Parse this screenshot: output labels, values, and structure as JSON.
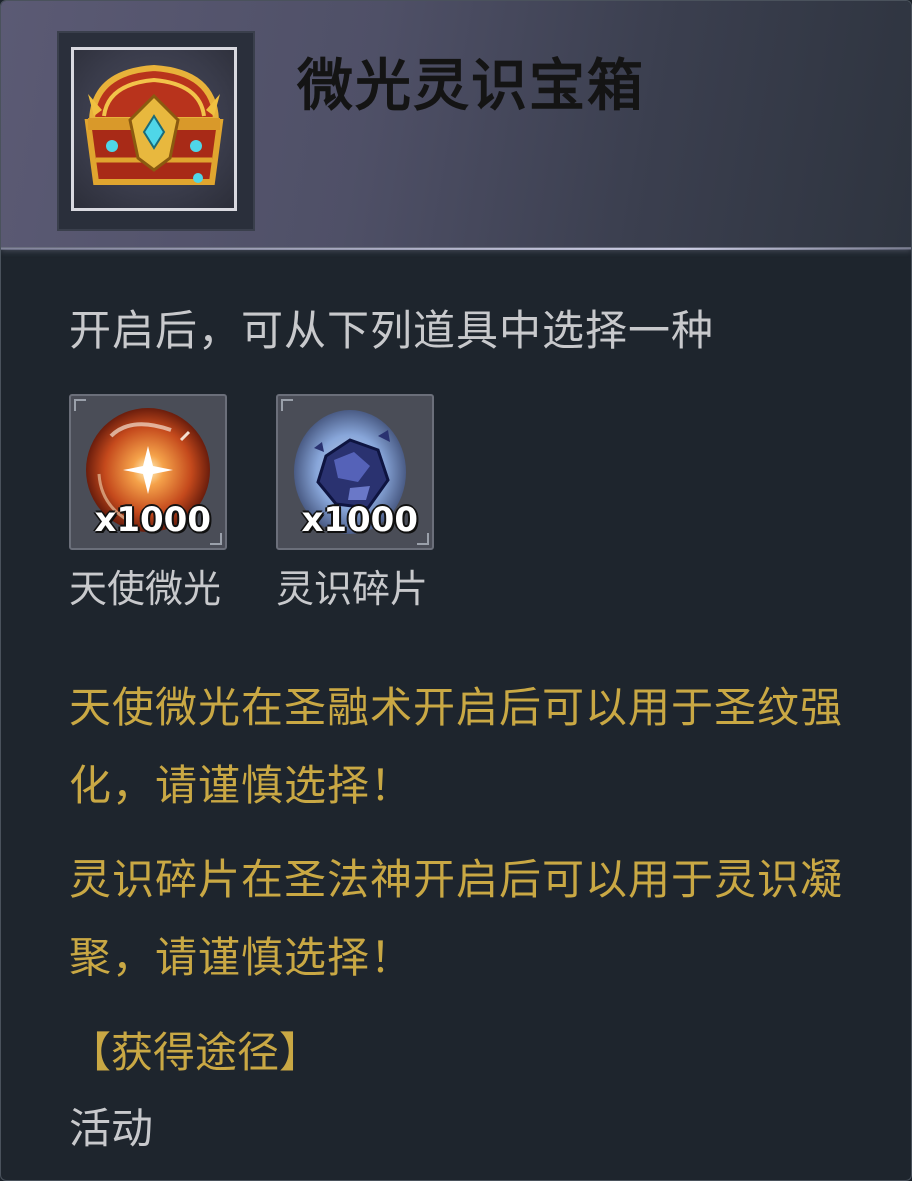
{
  "header": {
    "title": "微光灵识宝箱",
    "icon": "treasure-chest-icon"
  },
  "description": "开启后，可从下列道具中选择一种",
  "items": [
    {
      "name": "天使微光",
      "quantity": "x1000",
      "icon": "glowing-orb-icon",
      "color": "#e0622a"
    },
    {
      "name": "灵识碎片",
      "quantity": "x1000",
      "icon": "crystal-shard-icon",
      "color": "#3a4aa8"
    }
  ],
  "notes": [
    "天使微光在圣融术开启后可以用于圣纹强化，请谨慎选择！",
    "灵识碎片在圣法神开启后可以用于灵识凝聚，请谨慎选择！"
  ],
  "source": {
    "title": "【获得途径】",
    "value": "活动"
  },
  "colors": {
    "accent_gold": "#c9a844",
    "text_light": "#c8c9cc",
    "background": "#1e252d"
  }
}
